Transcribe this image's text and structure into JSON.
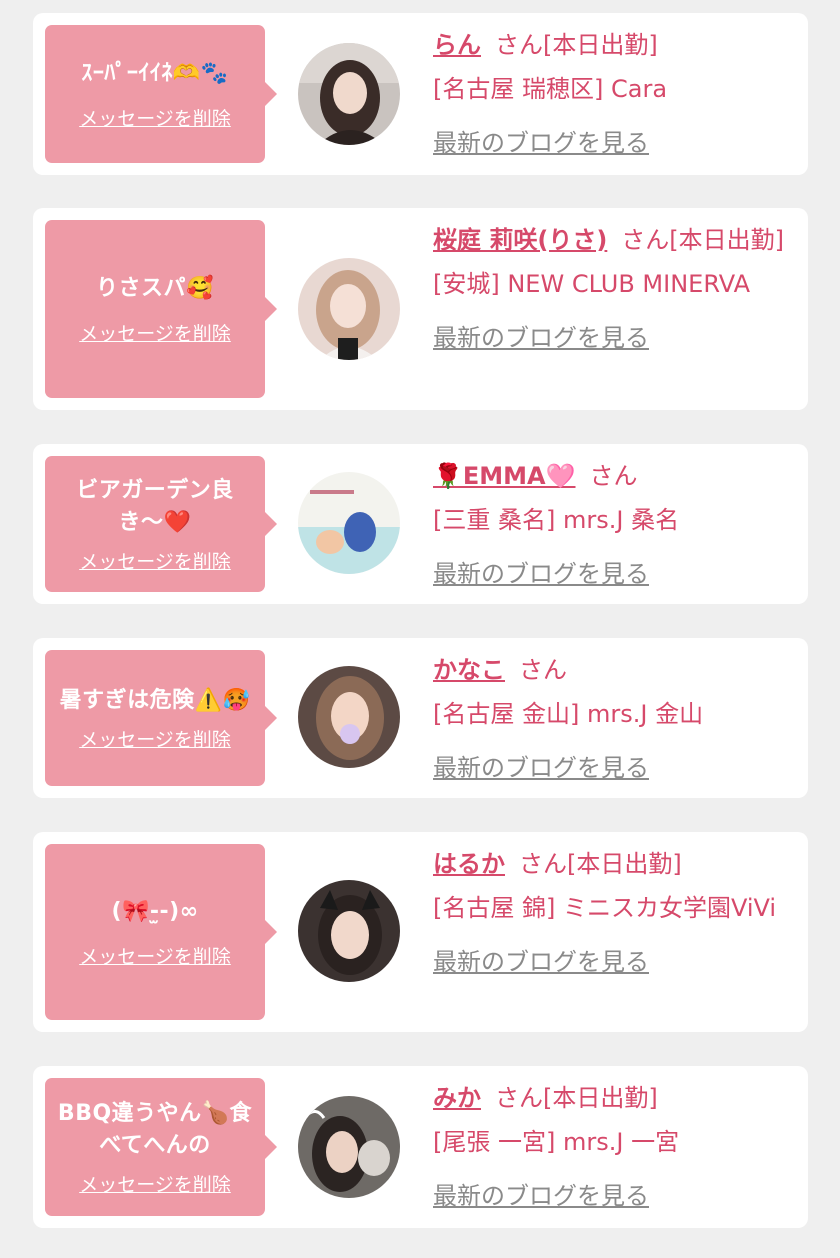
{
  "colors": {
    "background": "#efefef",
    "card": "#ffffff",
    "bubble": "#ee9aa6",
    "accent": "#d6496a",
    "blog_link": "#8a8a8a"
  },
  "entries": [
    {
      "message": "ｽｰﾊﾟｰｲｲﾈ🫶🐾",
      "delete_label": "メッセージを削除",
      "name": "らん",
      "suffix": "さん[本日出勤]",
      "shop": "[名古屋 瑞穂区] Cara",
      "blog_label": "最新のブログを見る"
    },
    {
      "message": "りさスパ🥰",
      "delete_label": "メッセージを削除",
      "name": "桜庭 莉咲(りさ)",
      "suffix": "さん[本日出勤]",
      "shop": "[安城] NEW CLUB MINERVA",
      "blog_label": "最新のブログを見る"
    },
    {
      "message": "ビアガーデン良き〜❤️",
      "delete_label": "メッセージを削除",
      "name": "🌹EMMA🩷",
      "suffix": "さん",
      "shop": "[三重 桑名] mrs.J 桑名",
      "blog_label": "最新のブログを見る"
    },
    {
      "message": "暑すぎは危険⚠️🥵",
      "delete_label": "メッセージを削除",
      "name": "かなこ",
      "suffix": "さん",
      "shop": "[名古屋 金山] mrs.J 金山",
      "blog_label": "最新のブログを見る"
    },
    {
      "message": "(🎀-̫-)∞",
      "delete_label": "メッセージを削除",
      "name": "はるか",
      "suffix": "さん[本日出勤]",
      "shop": "[名古屋 錦] ミニスカ女学園ViVi",
      "blog_label": "最新のブログを見る"
    },
    {
      "message": "BBQ違うやん🍗食べてへんの",
      "delete_label": "メッセージを削除",
      "name": "みか",
      "suffix": "さん[本日出勤]",
      "shop": "[尾張 一宮] mrs.J 一宮",
      "blog_label": "最新のブログを見る"
    }
  ]
}
